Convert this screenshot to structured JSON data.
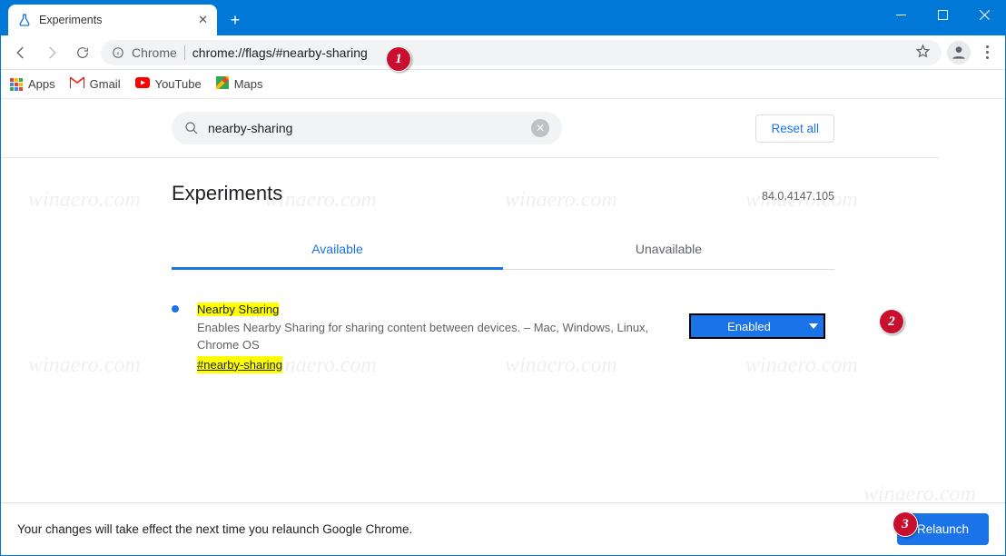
{
  "window": {
    "tab_title": "Experiments"
  },
  "toolbar": {
    "omni_scheme": "Chrome",
    "omni_url": "chrome://flags/#nearby-sharing"
  },
  "bookmarks": {
    "apps": "Apps",
    "gmail": "Gmail",
    "youtube": "YouTube",
    "maps": "Maps"
  },
  "page": {
    "search_value": "nearby-sharing",
    "reset_label": "Reset all",
    "title": "Experiments",
    "version": "84.0.4147.105",
    "tab_available": "Available",
    "tab_unavailable": "Unavailable"
  },
  "flag": {
    "title": "Nearby Sharing",
    "description": "Enables Nearby Sharing for sharing content between devices. – Mac, Windows, Linux, Chrome OS",
    "anchor": "#nearby-sharing",
    "select_value": "Enabled"
  },
  "footer": {
    "message": "Your changes will take effect the next time you relaunch Google Chrome.",
    "relaunch_label": "Relaunch"
  },
  "callouts": {
    "c1": "1",
    "c2": "2",
    "c3": "3"
  },
  "watermark": "winaero.com"
}
